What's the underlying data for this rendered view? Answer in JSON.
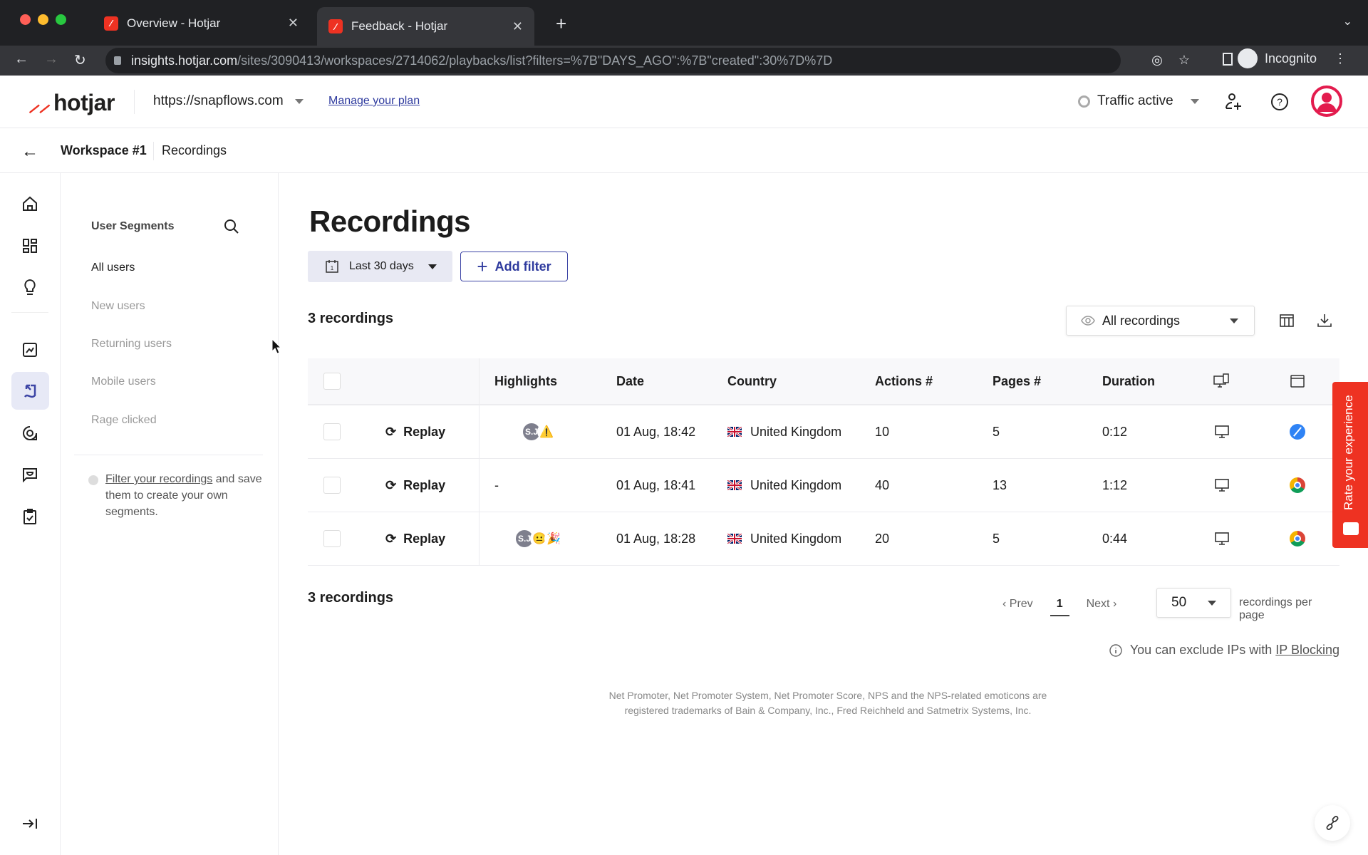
{
  "browser": {
    "tabs": [
      {
        "title": "Overview - Hotjar",
        "active": false
      },
      {
        "title": "Feedback - Hotjar",
        "active": true
      }
    ],
    "url_host": "insights.hotjar.com",
    "url_path": "/sites/3090413/workspaces/2714062/playbacks/list?filters=%7B\"DAYS_AGO\":%7B\"created\":30%7D%7D",
    "profile_label": "Incognito"
  },
  "header": {
    "logo_text": "hotjar",
    "site": "https://snapflows.com",
    "manage_plan": "Manage your plan",
    "traffic_status": "Traffic active",
    "avatar_color": "#e31c4e"
  },
  "breadcrumb": {
    "workspace": "Workspace #1",
    "current": "Recordings"
  },
  "rail": {
    "items": [
      "home-icon",
      "dashboards-icon",
      "highlights-icon",
      "trends-icon",
      "recordings-icon",
      "surveys-icon",
      "feedback-icon",
      "tasks-icon"
    ],
    "active": "recordings-icon",
    "accent": "#3d45a5"
  },
  "segments": {
    "heading": "User Segments",
    "items": [
      {
        "label": "All users",
        "active": true
      },
      {
        "label": "New users",
        "active": false
      },
      {
        "label": "Returning users",
        "active": false
      },
      {
        "label": "Mobile users",
        "active": false
      },
      {
        "label": "Rage clicked",
        "active": false
      }
    ],
    "tip_link": "Filter your recordings",
    "tip_rest": " and save them to create your own segments."
  },
  "main": {
    "title": "Recordings",
    "date_filter": "Last 30 days",
    "add_filter": "Add filter",
    "count_label": "3 recordings",
    "view_select": "All recordings",
    "columns": [
      "Highlights",
      "Date",
      "Country",
      "Actions #",
      "Pages #",
      "Duration"
    ],
    "replay_label": "Replay",
    "rows": [
      {
        "highlights": [
          "S.J",
          "warning"
        ],
        "date": "01 Aug, 18:42",
        "country": "United Kingdom",
        "actions": "10",
        "pages": "5",
        "duration": "0:12",
        "device": "desktop",
        "browser": "safari"
      },
      {
        "highlights": [],
        "highlights_text": "-",
        "date": "01 Aug, 18:41",
        "country": "United Kingdom",
        "actions": "40",
        "pages": "13",
        "duration": "1:12",
        "device": "desktop",
        "browser": "chrome"
      },
      {
        "highlights": [
          "S.J",
          "neutral-face",
          "party-popper"
        ],
        "date": "01 Aug, 18:28",
        "country": "United Kingdom",
        "actions": "20",
        "pages": "5",
        "duration": "0:44",
        "device": "desktop",
        "browser": "chrome"
      }
    ],
    "pager": {
      "prev": "Prev",
      "page": "1",
      "next": "Next",
      "per_page": "50",
      "per_page_label": "recordings per page"
    },
    "ip_note": "You can exclude IPs with ",
    "ip_link": "IP Blocking",
    "legal_1": "Net Promoter, Net Promoter System, Net Promoter Score, NPS and the NPS-related emoticons are",
    "legal_2": "registered trademarks of Bain & Company, Inc., Fred Reichheld and Satmetrix Systems, Inc."
  },
  "rate_widget": {
    "label": "Rate your experience",
    "color": "#ee3222"
  }
}
